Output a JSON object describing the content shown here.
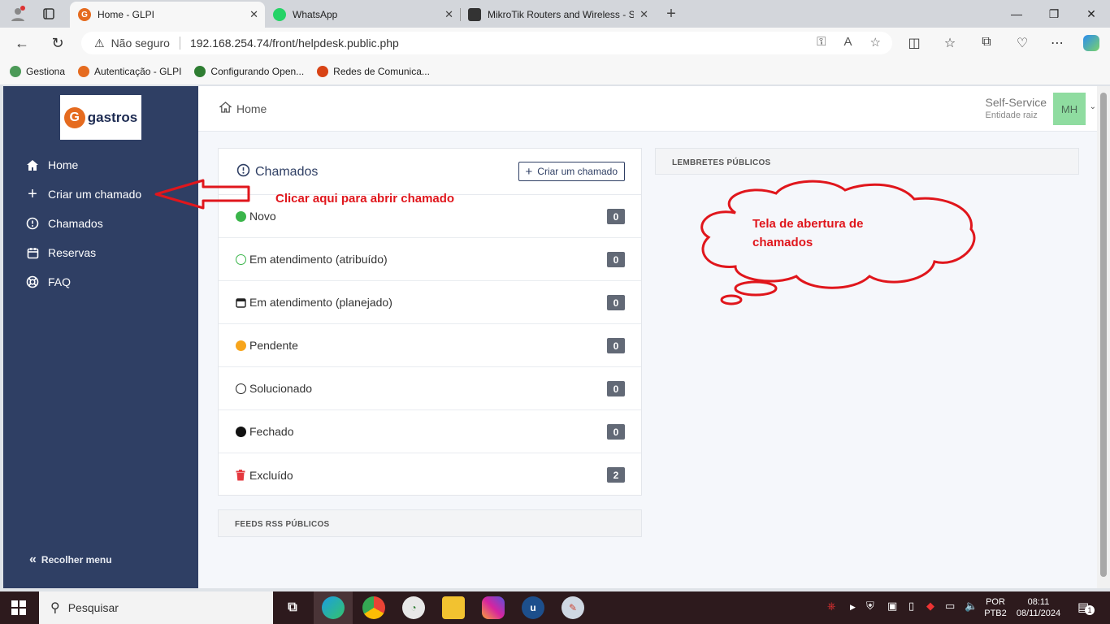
{
  "browser": {
    "tabs": [
      {
        "label": "Home - GLPI",
        "active": true
      },
      {
        "label": "WhatsApp",
        "active": false
      },
      {
        "label": "MikroTik Routers and Wireless - S",
        "active": false
      }
    ],
    "security_label": "Não seguro",
    "url": "192.168.254.74/front/helpdesk.public.php",
    "bookmarks": [
      {
        "label": "Gestiona",
        "color": "#4c9a58"
      },
      {
        "label": "Autenticação - GLPI",
        "color": "#e56b1f"
      },
      {
        "label": "Configurando Open...",
        "color": "#2e7d32"
      },
      {
        "label": "Redes de Comunica...",
        "color": "#d84315"
      }
    ]
  },
  "sidebar": {
    "logo_text": "gastros",
    "logo_mark": "G",
    "items": [
      {
        "label": "Home",
        "icon": "home-icon"
      },
      {
        "label": "Criar um chamado",
        "icon": "plus-icon"
      },
      {
        "label": "Chamados",
        "icon": "alert-circle-icon"
      },
      {
        "label": "Reservas",
        "icon": "calendar-icon"
      },
      {
        "label": "FAQ",
        "icon": "lifebuoy-icon"
      }
    ],
    "collapse_label": "Recolher menu"
  },
  "header": {
    "breadcrumb": "Home",
    "profile_name": "Self-Service",
    "entity": "Entidade raiz",
    "avatar_initials": "MH"
  },
  "tickets": {
    "title": "Chamados",
    "create_label": "Criar um chamado",
    "rows": [
      {
        "label": "Novo",
        "count": "0",
        "status": "new"
      },
      {
        "label": "Em atendimento (atribuído)",
        "count": "0",
        "status": "assigned"
      },
      {
        "label": "Em atendimento (planejado)",
        "count": "0",
        "status": "planned"
      },
      {
        "label": "Pendente",
        "count": "0",
        "status": "waiting"
      },
      {
        "label": "Solucionado",
        "count": "0",
        "status": "solved"
      },
      {
        "label": "Fechado",
        "count": "0",
        "status": "closed"
      },
      {
        "label": "Excluído",
        "count": "2",
        "status": "deleted"
      }
    ]
  },
  "rss_title": "FEEDS RSS PÚBLICOS",
  "reminders_title": "LEMBRETES PÚBLICOS",
  "annotations": {
    "arrow_text": "Clicar aqui para abrir chamado",
    "cloud_line1": "Tela de abertura de",
    "cloud_line2": "chamados"
  },
  "taskbar": {
    "search_placeholder": "Pesquisar",
    "lang_line1": "POR",
    "lang_line2": "PTB2",
    "time": "08:11",
    "date": "08/11/2024",
    "notification_count": "1"
  },
  "colors": {
    "sidebar": "#2f3f64",
    "status_new": "#3ab54a",
    "status_waiting": "#f7a51c",
    "annotation": "#e0161c"
  }
}
